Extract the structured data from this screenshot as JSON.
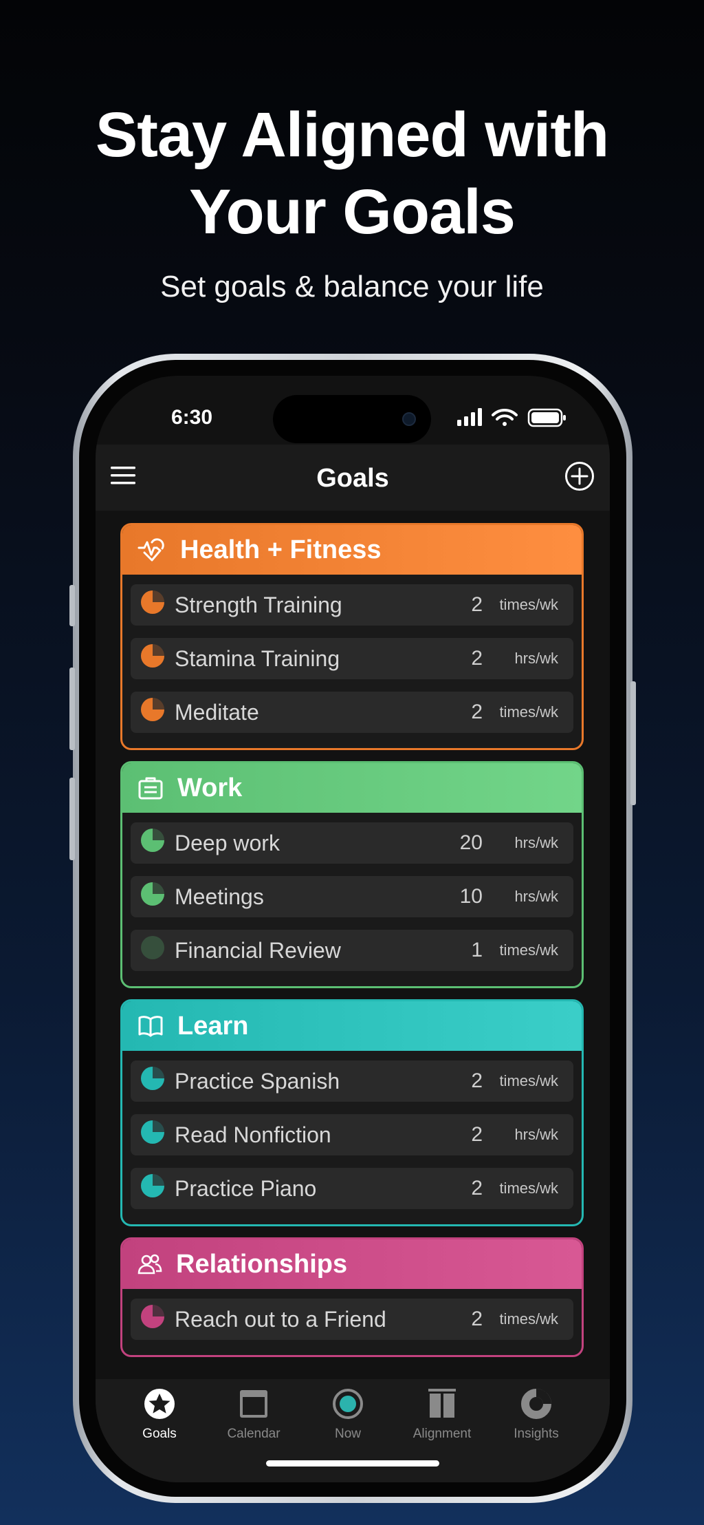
{
  "promo": {
    "headline_line1": "Stay Aligned with",
    "headline_line2": "Your Goals",
    "subhead": "Set goals & balance your life"
  },
  "status_bar": {
    "time": "6:30"
  },
  "nav": {
    "title": "Goals",
    "menu_icon": "hamburger-icon",
    "add_icon": "plus-circle-icon"
  },
  "categories": [
    {
      "name": "Health + Fitness",
      "icon": "heart-pulse-icon",
      "color": "#e8782a",
      "goals": [
        {
          "name": "Strength Training",
          "target": "2",
          "unit": "times/wk",
          "progress": 0.75
        },
        {
          "name": "Stamina Training",
          "target": "2",
          "unit": "hrs/wk",
          "progress": 0.75
        },
        {
          "name": "Meditate",
          "target": "2",
          "unit": "times/wk",
          "progress": 0.75
        }
      ]
    },
    {
      "name": "Work",
      "icon": "briefcase-icon",
      "color": "#5cbf73",
      "goals": [
        {
          "name": "Deep work",
          "target": "20",
          "unit": "hrs/wk",
          "progress": 0.75
        },
        {
          "name": "Meetings",
          "target": "10",
          "unit": "hrs/wk",
          "progress": 0.75
        },
        {
          "name": "Financial Review",
          "target": "1",
          "unit": "times/wk",
          "progress": 0
        }
      ]
    },
    {
      "name": "Learn",
      "icon": "open-book-icon",
      "color": "#24b8b2",
      "goals": [
        {
          "name": "Practice Spanish",
          "target": "2",
          "unit": "times/wk",
          "progress": 0.75
        },
        {
          "name": "Read Nonfiction",
          "target": "2",
          "unit": "hrs/wk",
          "progress": 0.75
        },
        {
          "name": "Practice Piano",
          "target": "2",
          "unit": "times/wk",
          "progress": 0.75
        }
      ]
    },
    {
      "name": "Relationships",
      "icon": "people-icon",
      "color": "#c2427e",
      "goals": [
        {
          "name": "Reach out to a Friend",
          "target": "2",
          "unit": "times/wk",
          "progress": 0.75
        }
      ]
    }
  ],
  "tabs": [
    {
      "label": "Goals",
      "icon": "star-icon",
      "active": true
    },
    {
      "label": "Calendar",
      "icon": "calendar-icon",
      "active": false
    },
    {
      "label": "Now",
      "icon": "target-icon",
      "active": false
    },
    {
      "label": "Alignment",
      "icon": "columns-icon",
      "active": false
    },
    {
      "label": "Insights",
      "icon": "donut-icon",
      "active": false
    }
  ]
}
